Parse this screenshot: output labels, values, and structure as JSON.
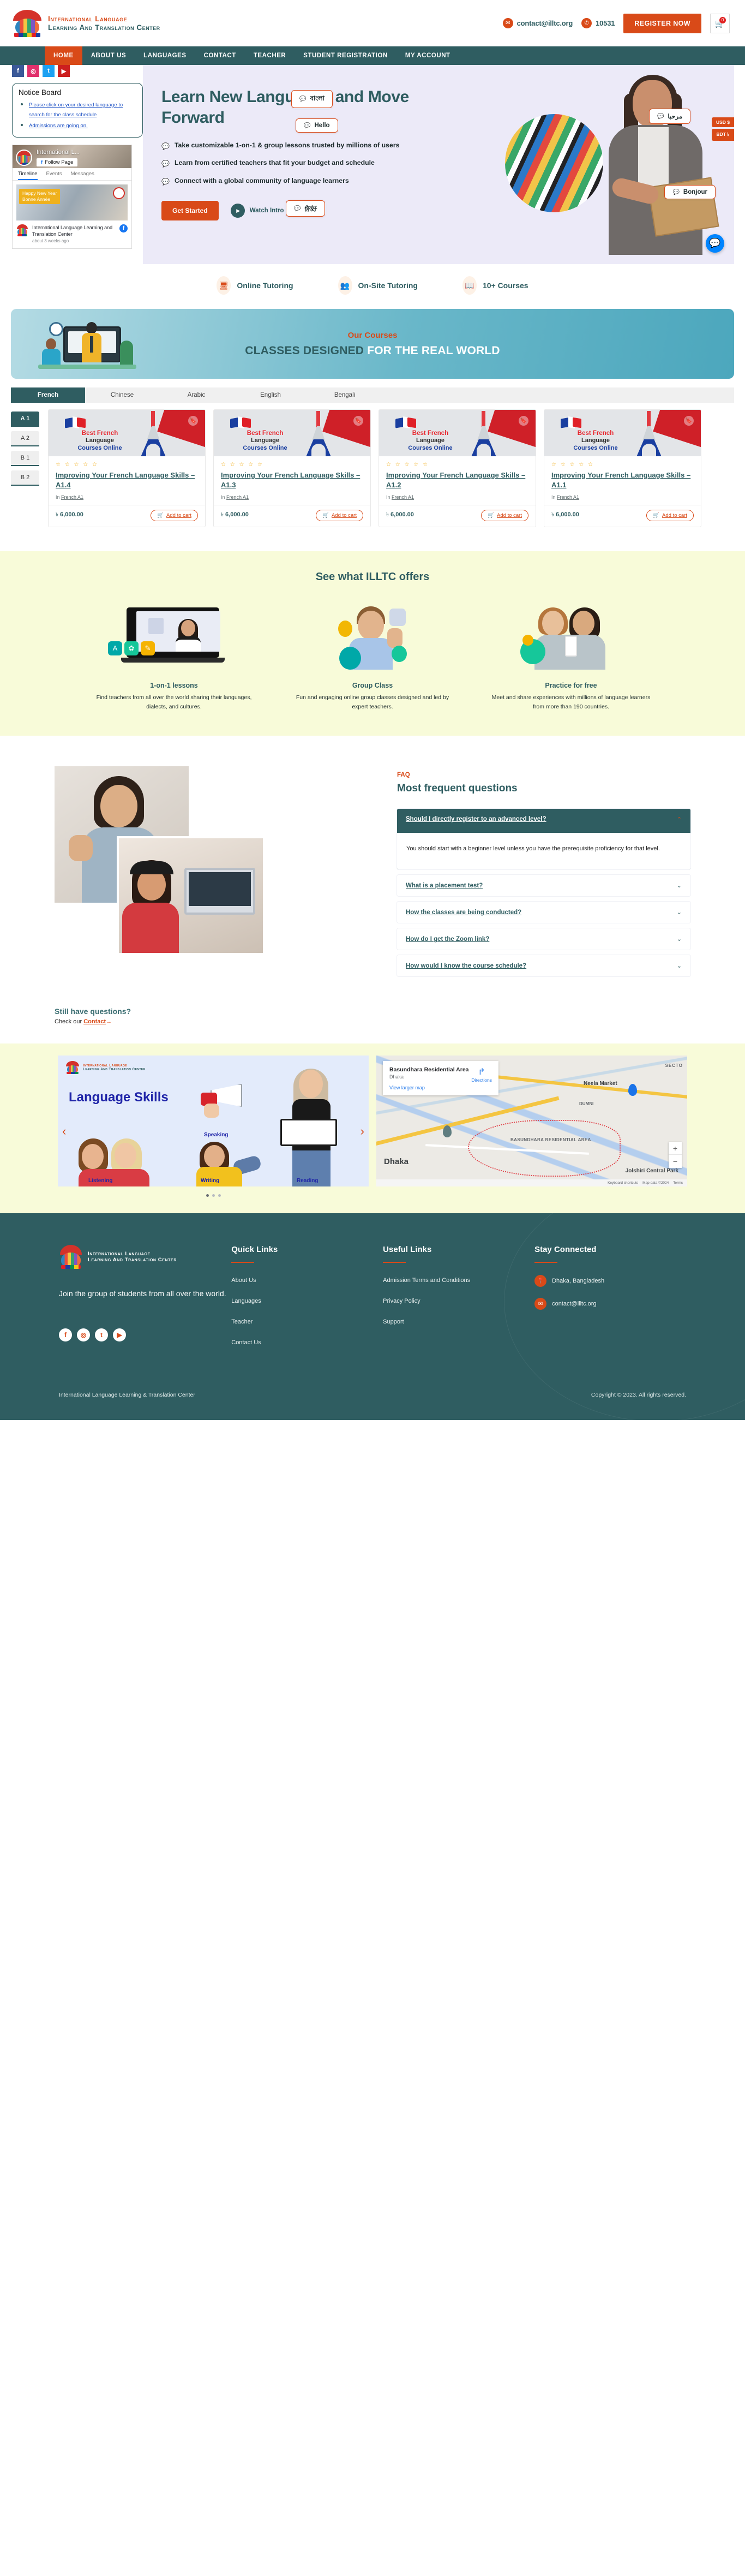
{
  "brand": {
    "line1": "International Language",
    "line2": "Learning And Translation Center",
    "footer_line1": "International Language",
    "footer_line2": "Learning And Translation Center"
  },
  "topbar": {
    "email": "contact@illtc.org",
    "phone": "10531",
    "register_label": "REGISTER NOW",
    "cart_count": "0"
  },
  "nav": {
    "items": [
      {
        "label": "HOME",
        "active": true
      },
      {
        "label": "ABOUT US",
        "active": false
      },
      {
        "label": "LANGUAGES",
        "active": false
      },
      {
        "label": "CONTACT",
        "active": false
      },
      {
        "label": "TEACHER",
        "active": false
      },
      {
        "label": "STUDENT REGISTRATION",
        "active": false
      },
      {
        "label": "MY ACCOUNT",
        "active": false
      }
    ]
  },
  "hero": {
    "title": "Learn New Languages and Move Forward",
    "bullets": [
      "Take customizable 1-on-1 & group lessons trusted by millions of users",
      "Learn from certified teachers that fit your budget and schedule",
      "Connect with a global community of language learners"
    ],
    "cta_primary": "Get Started",
    "cta_secondary": "Watch Intro",
    "bubbles": [
      {
        "text": "বাংলা"
      },
      {
        "text": "مرحبا"
      },
      {
        "text": "Hello"
      },
      {
        "text": "Bonjour"
      },
      {
        "text": "你好"
      }
    ],
    "currency_tabs": [
      "USD $",
      "BDT ৳"
    ]
  },
  "sidebar": {
    "socials": [
      "facebook-icon",
      "instagram-icon",
      "twitter-icon",
      "youtube-icon"
    ],
    "notice": {
      "title": "Notice Board",
      "items": [
        "Please click on your desired language to search for the class schedule",
        "Admissions are going on."
      ]
    },
    "facebook": {
      "page_title": "International L...",
      "follow_label": "Follow Page",
      "tabs": [
        "Timeline",
        "Events",
        "Messages"
      ],
      "post_banner_line1": "Happy New Year",
      "post_banner_line2": "Bonne Année",
      "post_page_name": "International Language Learning and Translation Center",
      "post_time": "about 3 weeks ago"
    }
  },
  "features": [
    {
      "label": "Online Tutoring",
      "icon": "monitor-icon"
    },
    {
      "label": "On-Site Tutoring",
      "icon": "group-icon"
    },
    {
      "label": "10+ Courses",
      "icon": "book-icon"
    }
  ],
  "courses_banner": {
    "kicker": "Our Courses",
    "headline_bold": "CLASSES DESIGNED",
    "headline_light": "FOR THE REAL WORLD"
  },
  "language_tabs": [
    {
      "label": "French",
      "active": true
    },
    {
      "label": "Chinese",
      "active": false
    },
    {
      "label": "Arabic",
      "active": false
    },
    {
      "label": "English",
      "active": false
    },
    {
      "label": "Bengali",
      "active": false
    }
  ],
  "levels": [
    {
      "label": "A 1",
      "active": true
    },
    {
      "label": "A 2",
      "active": false
    },
    {
      "label": "B 1",
      "active": false
    },
    {
      "label": "B 2",
      "active": false
    }
  ],
  "course_card_common": {
    "badge_line1": "Best French",
    "badge_line2": "Language",
    "badge_line3": "Courses Online",
    "stars": "☆ ☆ ☆ ☆ ☆",
    "in_label": "In",
    "category": "French A1",
    "currency": "৳",
    "add_to_cart": "Add to cart"
  },
  "courses": [
    {
      "title": "Improving Your French Language Skills – A1.4",
      "price": "6,000.00"
    },
    {
      "title": "Improving Your French Language Skills – A1.3",
      "price": "6,000.00"
    },
    {
      "title": "Improving Your French Language Skills – A1.2",
      "price": "6,000.00"
    },
    {
      "title": "Improving Your French Language Skills – A1.1",
      "price": "6,000.00"
    }
  ],
  "offers": {
    "heading": "See what ILLTC offers",
    "items": [
      {
        "title": "1-on-1 lessons",
        "desc": "Find teachers from all over the world sharing their languages, dialects, and cultures."
      },
      {
        "title": "Group Class",
        "desc": "Fun and engaging online group classes designed and led by expert teachers."
      },
      {
        "title": "Practice for free",
        "desc": "Meet and share experiences with millions of language learners from more than 190 countries."
      }
    ]
  },
  "faq": {
    "kicker": "FAQ",
    "heading": "Most frequent questions",
    "items": [
      {
        "q": "Should I directly register to an advanced level?",
        "a": "You should start with a beginner level unless you have the prerequisite proficiency for that level.",
        "open": true
      },
      {
        "q": "What is a placement test?",
        "a": "",
        "open": false
      },
      {
        "q": "How the classes are being conducted?",
        "a": "",
        "open": false
      },
      {
        "q": "How do I get the Zoom link?",
        "a": "",
        "open": false
      },
      {
        "q": "How would I know the course schedule?",
        "a": "",
        "open": false
      }
    ]
  },
  "still": {
    "heading": "Still have questions?",
    "prefix": "Check our ",
    "link": "Contact",
    "arrow": "→"
  },
  "slide": {
    "title": "Language Skills",
    "labels": {
      "speaking": "Speaking",
      "listening": "Listening",
      "writing": "Writing",
      "reading": "Reading"
    },
    "prev": "‹",
    "next": "›"
  },
  "map": {
    "place": "Basundhara Residential Area",
    "city": "Dhaka",
    "directions": "Directions",
    "view_larger": "View larger map",
    "labels": {
      "dhaka": "Dhaka",
      "basundhara": "BASUNDHARA RESIDENTIAL AREA",
      "neela": "Neela Market",
      "dumni": "DUMNI",
      "sector": "SECTO",
      "jolshiri": "Jolshiri Central Park"
    },
    "attrib": [
      "Keyboard shortcuts",
      "Map data ©2024",
      "Terms"
    ],
    "zoom_in": "+",
    "zoom_out": "−"
  },
  "footer": {
    "tagline": "Join the group of students from all over the world.",
    "socials": [
      "facebook-icon",
      "instagram-icon",
      "twitter-icon",
      "youtube-icon"
    ],
    "quick_links": {
      "title": "Quick Links",
      "items": [
        "About Us",
        "Languages",
        "Teacher",
        "Contact Us"
      ]
    },
    "useful_links": {
      "title": "Useful Links",
      "items": [
        "Admission Terms and Conditions",
        "Privacy Policy",
        "Support"
      ]
    },
    "stay_connected": {
      "title": "Stay Connected",
      "address": "Dhaka, Bangladesh",
      "email": "contact@illtc.org"
    },
    "copyright_left": "International Language Learning & Translation Center",
    "copyright_right": "Copyright © 2023. All rights reserved."
  },
  "colors": {
    "teal": "#2f5d61",
    "orange": "#d94a18",
    "hero_bg": "#eceaf8",
    "lime_bg": "#f8fbd9"
  }
}
